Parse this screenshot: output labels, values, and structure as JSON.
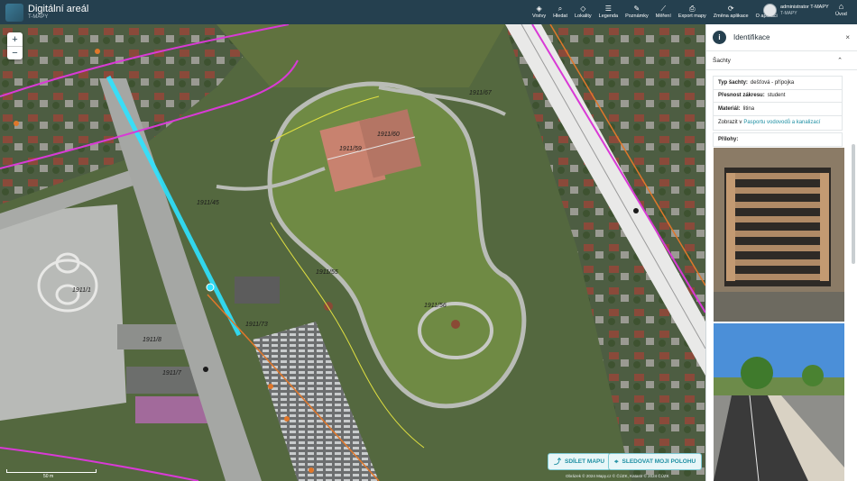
{
  "header": {
    "app_title": "Digitální areál",
    "app_subtitle": "T-MAPY",
    "tools": [
      {
        "icon": "layers-icon",
        "glyph": "◈",
        "label": "Vrstvy"
      },
      {
        "icon": "search-icon",
        "glyph": "⌕",
        "label": "Hledat"
      },
      {
        "icon": "location-icon",
        "glyph": "◇",
        "label": "Lokality"
      },
      {
        "icon": "legend-icon",
        "glyph": "☰",
        "label": "Legenda"
      },
      {
        "icon": "pencil-icon",
        "glyph": "✎",
        "label": "Poznámky"
      },
      {
        "icon": "ruler-icon",
        "glyph": "⟋",
        "label": "Měření"
      },
      {
        "icon": "print-icon",
        "glyph": "⎙",
        "label": "Export mapy"
      },
      {
        "icon": "refresh-icon",
        "glyph": "⟳",
        "label": "Změna aplikace"
      },
      {
        "icon": "help-icon",
        "glyph": "?",
        "label": "O aplikaci"
      }
    ],
    "user_name": "administrator T-MAPY",
    "user_role": "T-MAPY",
    "home_label": "Úvod"
  },
  "map": {
    "zoom_in": "+",
    "zoom_out": "−",
    "share_button": "SDÍLET MAPU",
    "track_button": "SLEDOVAT MOJI POLOHU",
    "attribution": "Obrázek © 2024 Mapy.cz © ČÚZK, Katastr © 2024 ČÚZK",
    "scale_label": "50 m",
    "parcel_labels": [
      "1911/60",
      "1911/59",
      "1911/56",
      "1911/45",
      "1911/1",
      "1911/8",
      "1911/7",
      "1911/73",
      "1911/55",
      "1911/67"
    ]
  },
  "panel": {
    "title": "Identifikace",
    "info_glyph": "i",
    "close_glyph": "×",
    "section_title": "Šachty",
    "chevron": "⌃",
    "attributes": [
      {
        "key": "Typ šachty:",
        "value": "dešťová - přípojka"
      },
      {
        "key": "Přesnost zákresu:",
        "value": "student"
      },
      {
        "key": "Materiál:",
        "value": "litina"
      }
    ],
    "link_prefix": "Zobrazit v",
    "link_text": "Pasportu vodovodů a kanalizací",
    "attachments_label": "Přílohy:"
  },
  "colors": {
    "header_bg": "#25404f",
    "accent": "#1e8fa3",
    "highlight_pipe": "#2fe3ff",
    "water_line": "#d93ad6"
  }
}
